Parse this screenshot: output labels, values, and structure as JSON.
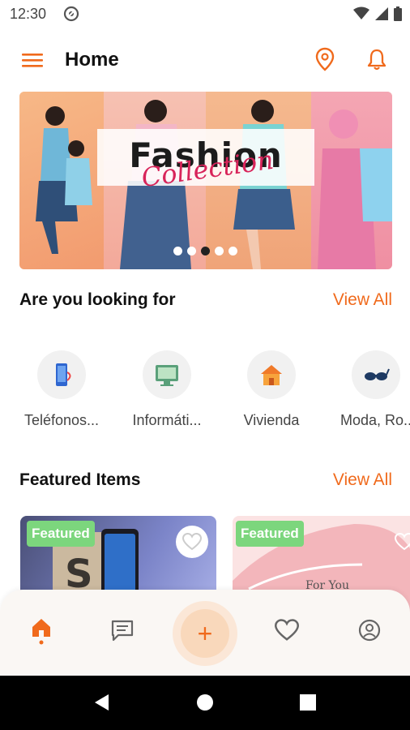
{
  "status": {
    "time": "12:30"
  },
  "header": {
    "title": "Home"
  },
  "banner": {
    "title": "Fashion",
    "subtitle": "Collection",
    "dots": [
      false,
      false,
      true,
      false,
      false
    ]
  },
  "sections": {
    "looking": {
      "title": "Are you looking for",
      "view_all": "View All"
    },
    "featured": {
      "title": "Featured Items",
      "view_all": "View All"
    }
  },
  "categories": [
    {
      "label": "Teléfonos...",
      "icon": "phone-icon"
    },
    {
      "label": "Informáti...",
      "icon": "computer-icon"
    },
    {
      "label": "Vivienda",
      "icon": "house-icon"
    },
    {
      "label": "Moda, Ro..",
      "icon": "sunglasses-icon"
    }
  ],
  "featured_items": [
    {
      "badge": "Featured"
    },
    {
      "badge": "Featured"
    }
  ],
  "colors": {
    "accent": "#f06a1c",
    "badge": "#7cd67d"
  }
}
